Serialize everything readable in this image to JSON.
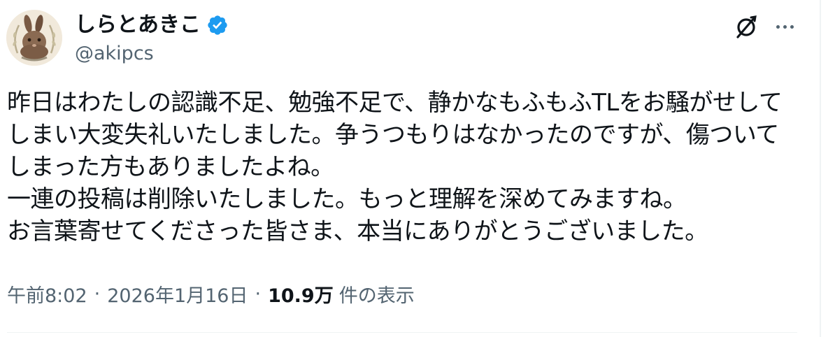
{
  "author": {
    "display_name": "しらとあきこ",
    "handle": "@akipcs",
    "verified": true,
    "verified_color": "#1d9bf0"
  },
  "actions": {
    "grok_icon": "grok-icon",
    "more_icon": "more-icon"
  },
  "tweet": {
    "lines": [
      "昨日はわたしの認識不足、勉強不足で、静かなもふもふTLをお騒がせして",
      "しまい大変失礼いたしました。争うつもりはなかったのですが、傷ついて",
      "しまった方もありましたよね。",
      "一連の投稿は削除いたしました。もっと理解を深めてみますね。",
      "お言葉寄せてくださった皆さま、本当にありがとうございました。"
    ]
  },
  "meta": {
    "time": "午前8:02",
    "separator": "·",
    "date": "2026年1月16日",
    "views_count": "10.9万",
    "views_label": "件の表示"
  },
  "colors": {
    "text_primary": "#0f1419",
    "text_secondary": "#536471",
    "border": "#eff3f4"
  }
}
